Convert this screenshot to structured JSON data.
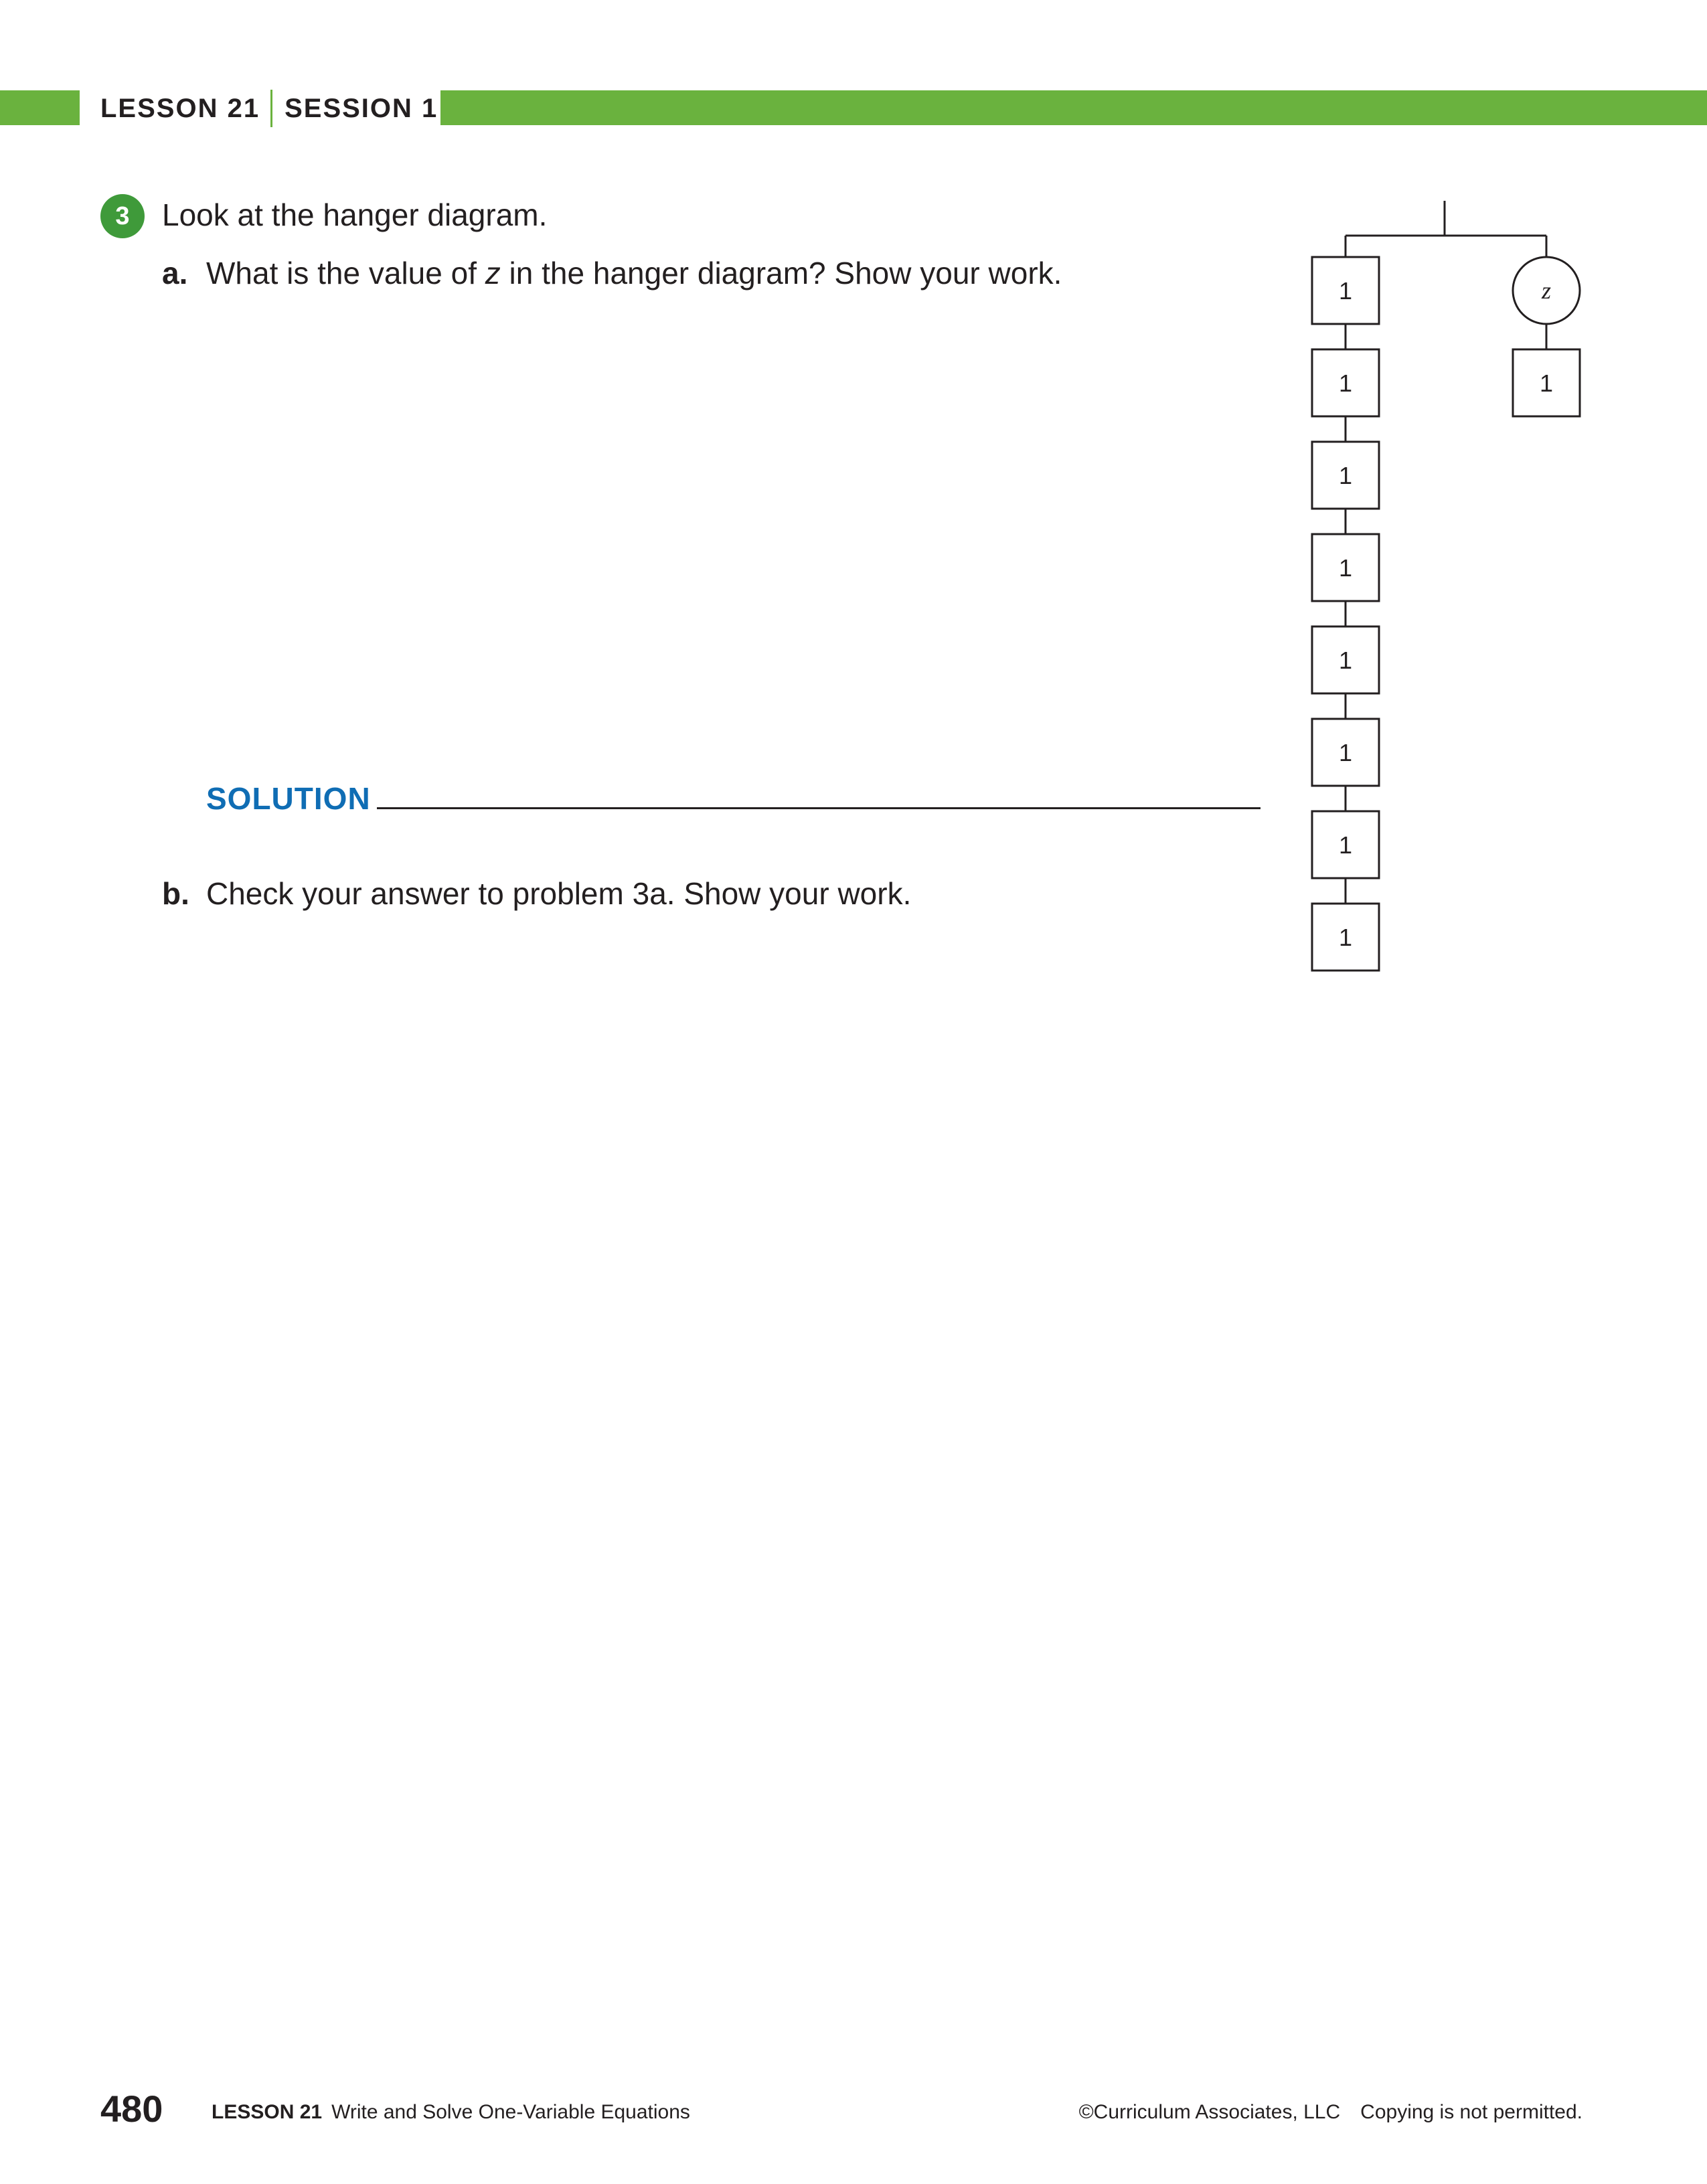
{
  "header": {
    "lesson": "LESSON 21",
    "session": "SESSION 1"
  },
  "question": {
    "number": "3",
    "prompt": "Look at the hanger diagram.",
    "part_a": {
      "label": "a.",
      "text_before": "What is the value of ",
      "variable": "z",
      "text_after": " in the hanger diagram? Show your work."
    },
    "solution_label": "SOLUTION",
    "part_b": {
      "label": "b.",
      "text": "Check your answer to problem 3a. Show your work."
    }
  },
  "diagram": {
    "left_blocks": [
      "1",
      "1",
      "1",
      "1",
      "1",
      "1",
      "1",
      "1"
    ],
    "right_variable": "z",
    "right_blocks": [
      "1"
    ]
  },
  "footer": {
    "page_number": "480",
    "lesson": "LESSON 21",
    "lesson_title": "Write and Solve One-Variable Equations",
    "copyright": "©Curriculum Associates, LLC",
    "notice": "Copying is not permitted."
  },
  "colors": {
    "green": "#6ab23e",
    "badge_green": "#3f9a3a",
    "solution_blue": "#0f6db4",
    "text": "#231f20"
  }
}
